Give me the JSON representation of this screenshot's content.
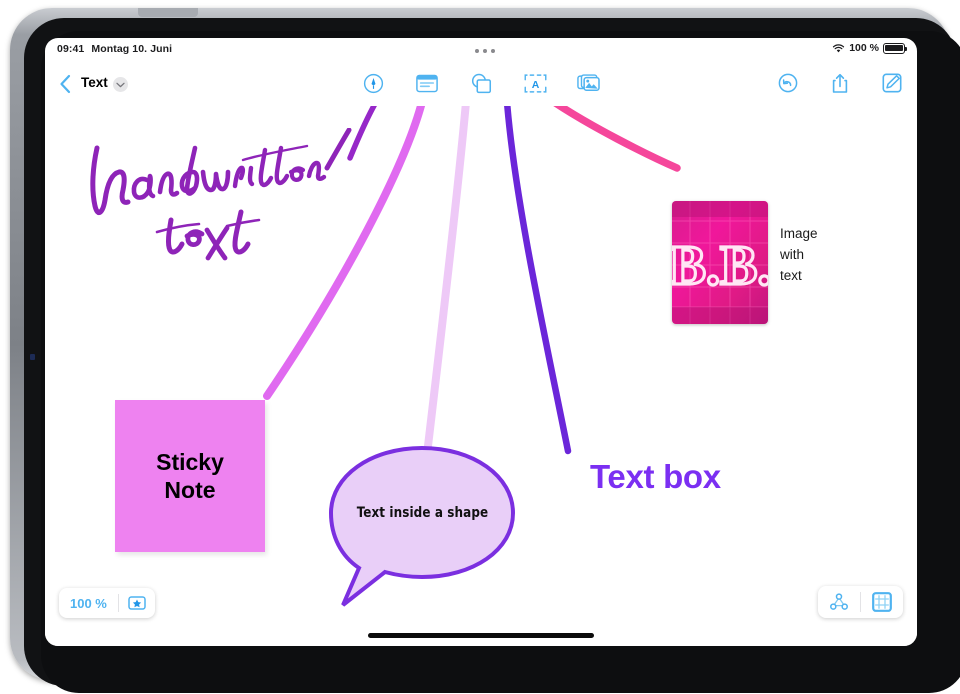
{
  "status_bar": {
    "time": "09:41",
    "date": "Montag 10. Juni",
    "battery_percent": "100 %",
    "wifi_icon": "wifi-icon",
    "battery_icon": "battery-icon",
    "multitask_icon": "multitasking-dots-icon"
  },
  "navbar": {
    "back_icon": "chevron-left-icon",
    "title": "Text",
    "title_chevron_icon": "chevron-down-icon",
    "tools": [
      {
        "name": "markup-pen-tool",
        "icon": "pen-in-circle-icon",
        "label": "Markup"
      },
      {
        "name": "sticky-note-tool",
        "icon": "sticky-note-icon",
        "label": "Sticky Note"
      },
      {
        "name": "shapes-tool",
        "icon": "shapes-icon",
        "label": "Shapes"
      },
      {
        "name": "text-box-tool",
        "icon": "text-box-icon",
        "label": "Text Box"
      },
      {
        "name": "media-tool",
        "icon": "photos-stack-icon",
        "label": "Media"
      }
    ],
    "actions": [
      {
        "name": "undo-button",
        "icon": "undo-arrow-icon",
        "label": "Undo"
      },
      {
        "name": "share-button",
        "icon": "share-up-arrow-icon",
        "label": "Share"
      },
      {
        "name": "compose-button",
        "icon": "compose-pencil-icon",
        "label": "Compose"
      }
    ]
  },
  "canvas": {
    "handwritten": {
      "line1": "handwritten",
      "line2": "text",
      "color": "#8E24B8"
    },
    "sticky_note": {
      "line1": "Sticky",
      "line2": "Note",
      "fill": "#EE82F0",
      "text_color": "#000000"
    },
    "shape_bubble": {
      "text": "Text inside a shape",
      "fill": "#E8CDF8",
      "stroke": "#7B2FE0"
    },
    "text_box": {
      "text": "Text box",
      "color": "#7B2FF2"
    },
    "image_object": {
      "image_text": "B.B.",
      "caption_line1": "Image",
      "caption_line2": "with",
      "caption_line3": "text"
    },
    "connectors": [
      {
        "name": "connector-markup-to-handwriting",
        "color": "#B43CE8"
      },
      {
        "name": "connector-sticky-note",
        "color": "#E06AF0"
      },
      {
        "name": "connector-shapes",
        "color": "#EBC6F5"
      },
      {
        "name": "connector-text-box",
        "color": "#7B2FE0"
      },
      {
        "name": "connector-media",
        "color": "#F5479B"
      }
    ]
  },
  "bottom_bar": {
    "zoom_level": "100 %",
    "star_icon": "star-in-rectangle-icon",
    "nodes_icon": "connected-nodes-icon",
    "grid_icon": "grid-view-icon"
  }
}
